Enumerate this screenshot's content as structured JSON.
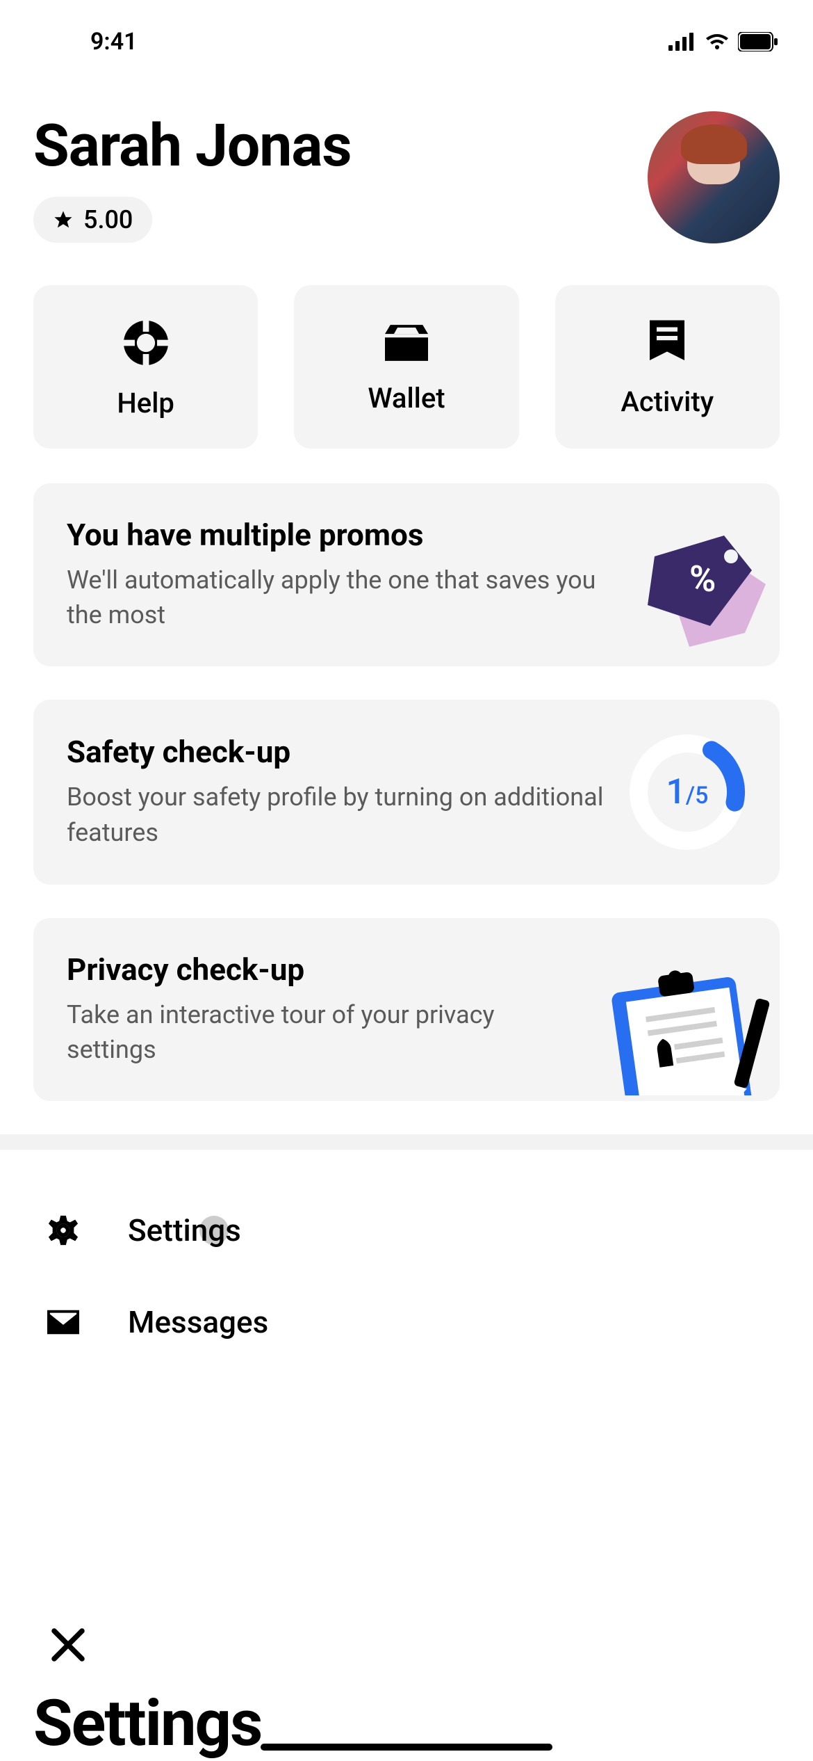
{
  "status": {
    "time": "9:41"
  },
  "profile": {
    "name": "Sarah Jonas",
    "rating": "5.00"
  },
  "quickActions": {
    "help": "Help",
    "wallet": "Wallet",
    "activity": "Activity"
  },
  "cards": {
    "promos": {
      "title": "You have multiple promos",
      "desc": "We'll automatically apply the one that saves you the most"
    },
    "safety": {
      "title": "Safety check-up",
      "desc": "Boost your safety profile by turning on additional features",
      "progress": "1",
      "total": "/5"
    },
    "privacy": {
      "title": "Privacy check-up",
      "desc": "Take an interactive tour of your privacy settings"
    }
  },
  "menu": {
    "settings": "Settings",
    "messages": "Messages"
  },
  "overlay": {
    "title": "Settings"
  }
}
